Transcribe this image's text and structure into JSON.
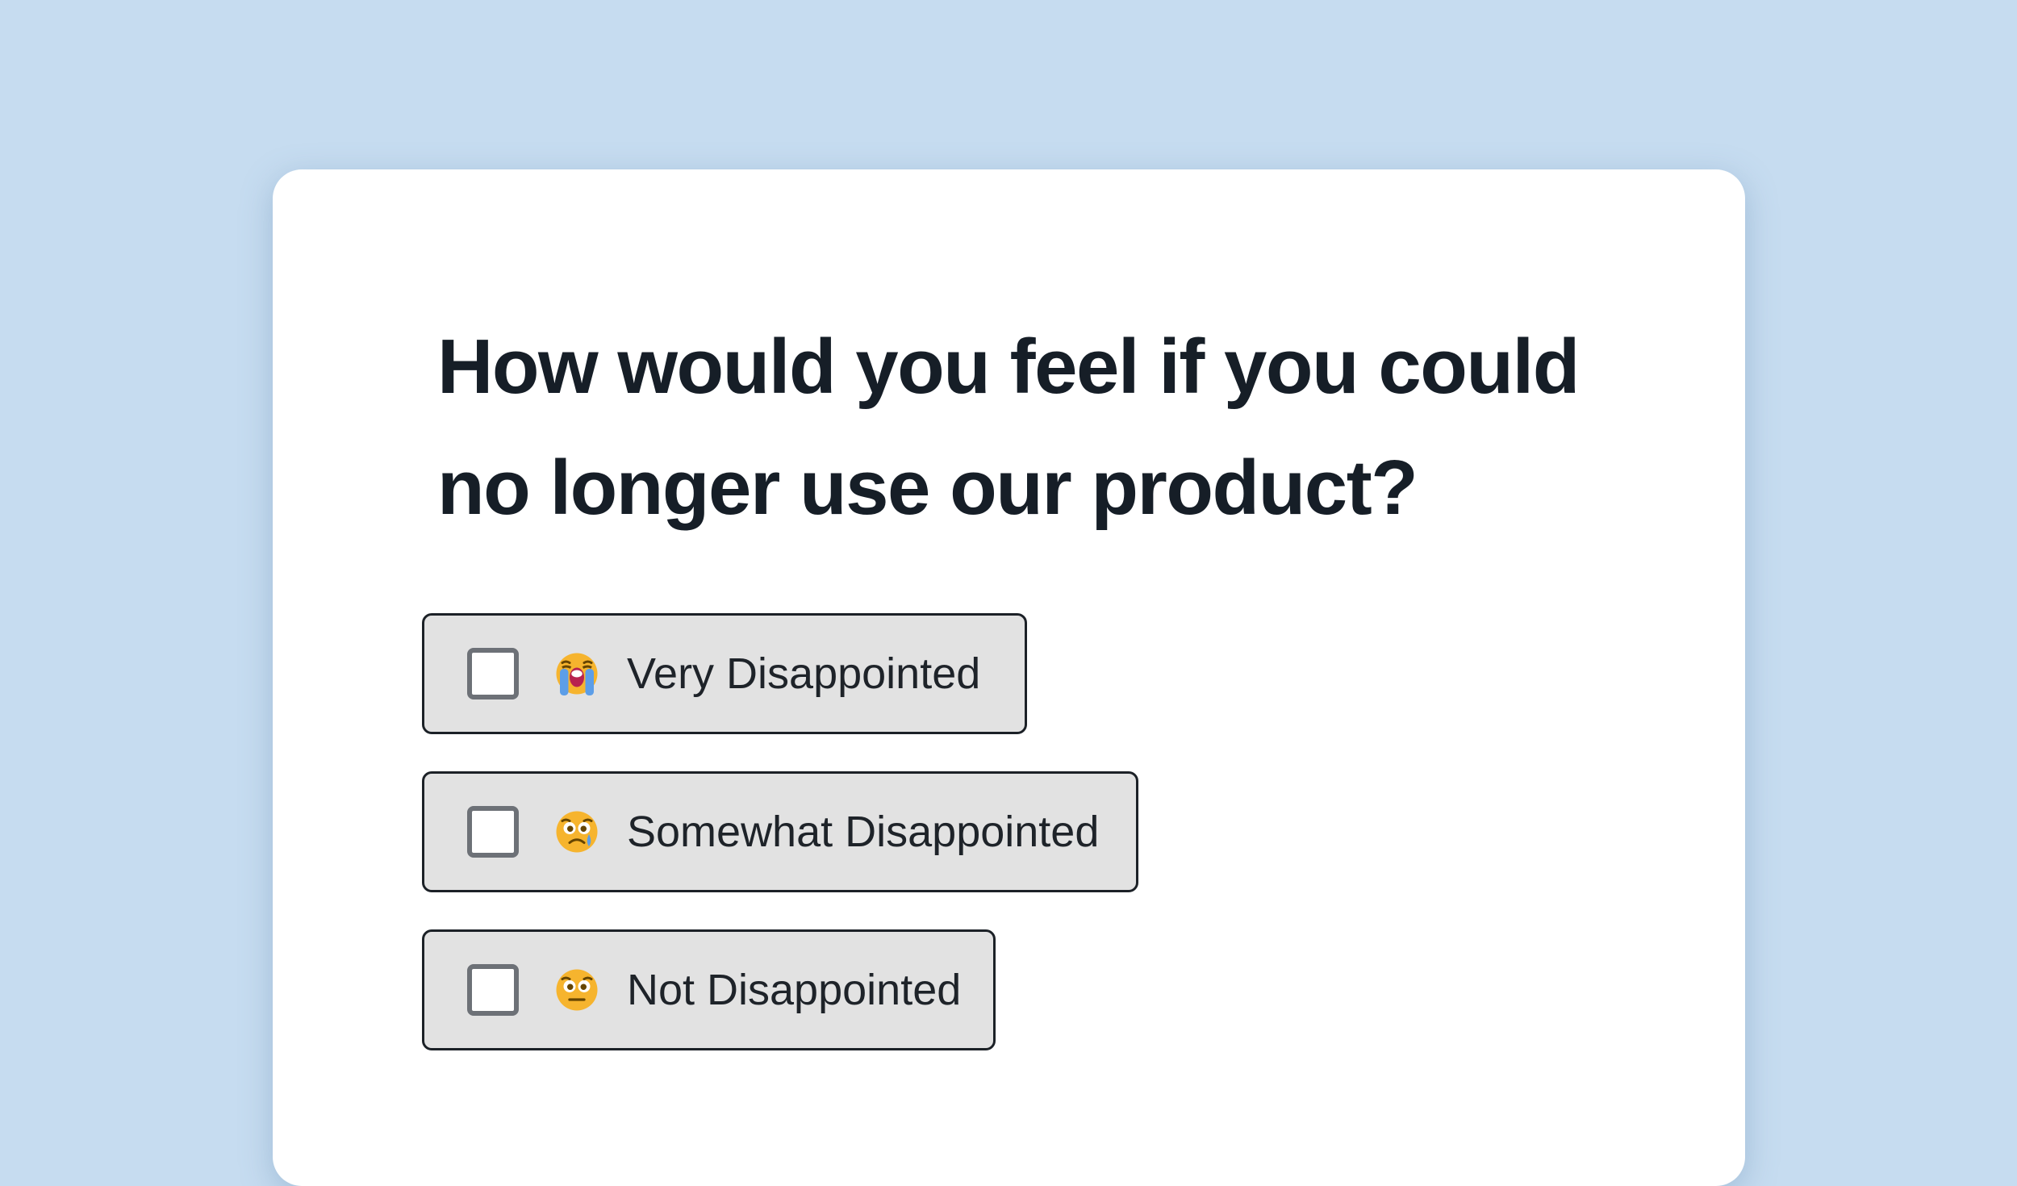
{
  "survey": {
    "question": "How would you feel if you could no longer use our product?",
    "options": [
      {
        "label": "Very Disappointed",
        "emoji": "loudly-crying-face",
        "checked": false
      },
      {
        "label": "Somewhat Disappointed",
        "emoji": "crying-face",
        "checked": false
      },
      {
        "label": "Not Disappointed",
        "emoji": "neutral-face",
        "checked": false
      }
    ]
  },
  "colors": {
    "background": "#c6dcf0",
    "card": "#ffffff",
    "question_text": "#161e27",
    "option_fill": "#e2e2e2",
    "option_border": "#1c2127",
    "checkbox_border": "#6d7177",
    "emoji_yellow": "#f6b42e"
  }
}
